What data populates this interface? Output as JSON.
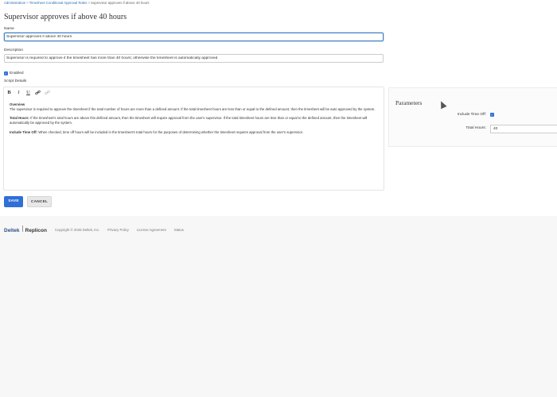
{
  "breadcrumb": {
    "items": [
      "Administration",
      "Timesheet Conditional Approval Rules",
      "Supervisor approves if above 40 hours"
    ],
    "separator": ">"
  },
  "page": {
    "title": "Supervisor approves if above 40 hours"
  },
  "form": {
    "name_label": "Name",
    "name_value": "Supervisor approves if above 40 hours",
    "description_label": "Description",
    "description_value": "Supervisor is required to approve if the timesheet has more than 40 hours; otherwise the timesheet is automatically approved",
    "enabled_label": "Enabled",
    "enabled_checked": true,
    "script_details_label": "Script Details"
  },
  "editor": {
    "toolbar": {
      "bold": "B",
      "italic": "I",
      "underline": "U",
      "link_icon": "link-icon",
      "unlink_icon": "unlink-icon"
    },
    "overview_heading": "Overview",
    "overview_text": "The supervisor is required to approve the timesheet if the total number of hours are more than a defined amount. If the total timesheet hours are less than or equal to the defined amount, then the timesheet will be auto approved by the system.",
    "total_hours_heading": "Total Hours:",
    "total_hours_text": " If the timesheet's total hours are above this defined amount, then the timesheet will require approval from the user's supervisor. If the total timesheet hours are less than or equal to the defined amount, then the timesheet will automatically be approved by the system.",
    "include_time_off_heading": "Include Time Off:",
    "include_time_off_text": " When checked, time off hours will be included in the timesheet's total hours for the purposes of determining whether the timesheet requires approval from the user's supervisor."
  },
  "parameters": {
    "title": "Parameters",
    "include_time_off_label": "Include Time Off:",
    "include_time_off_checked": true,
    "total_hours_label": "Total Hours:",
    "total_hours_value": "40"
  },
  "actions": {
    "save_label": "SAVE",
    "cancel_label": "CANCEL"
  },
  "footer": {
    "brand_left": "Deltek",
    "brand_right": "Replicon",
    "copyright": "Copyright © 2026 Deltek, Inc.",
    "links": [
      "Privacy Policy",
      "License Agreement",
      "Status"
    ]
  },
  "colors": {
    "primary": "#2f6fd6",
    "link": "#2a6fb5",
    "border": "#cccccc"
  },
  "cursor_icon": "mouse-pointer-icon"
}
